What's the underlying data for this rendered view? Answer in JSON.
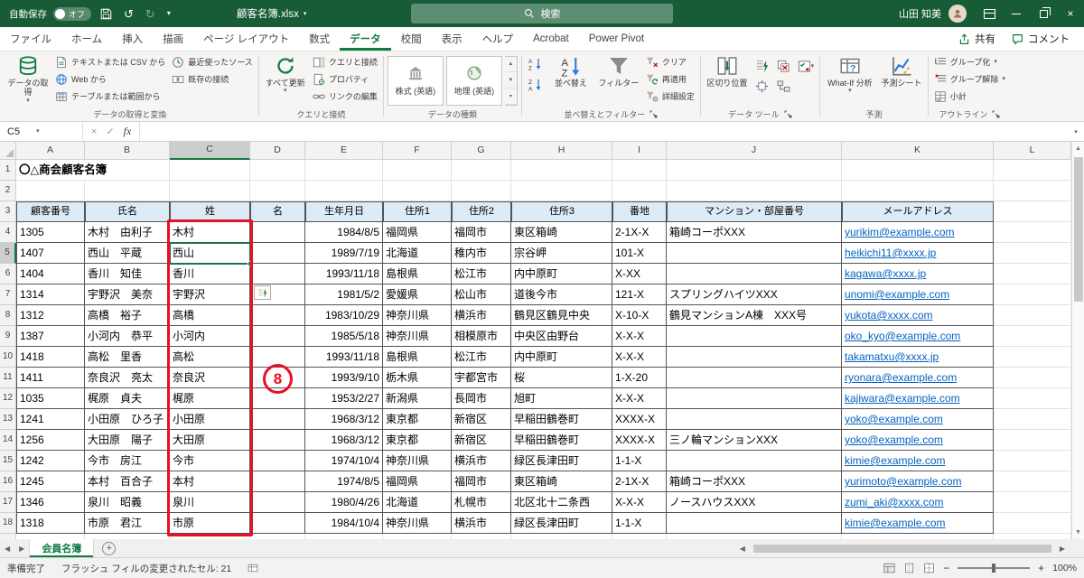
{
  "glyphs": {
    "chevron_down": "▾",
    "undo": "↺",
    "redo": "↻",
    "close": "×",
    "scroll_left": "◀",
    "scroll_right": "▶",
    "up": "▲",
    "down": "▼",
    "add_sheet": "+",
    "zoom_out": "−",
    "zoom_in": "+"
  },
  "titlebar": {
    "autosave_label": "自動保存",
    "autosave_state": "オフ",
    "filename": "顧客名簿.xlsx",
    "search_placeholder": "検索",
    "user_name": "山田 知美"
  },
  "ribbon": {
    "tabs": [
      "ファイル",
      "ホーム",
      "挿入",
      "描画",
      "ページ レイアウト",
      "数式",
      "データ",
      "校閲",
      "表示",
      "ヘルプ",
      "Acrobat",
      "Power Pivot"
    ],
    "active_tab": "データ",
    "share_label": "共有",
    "comments_label": "コメント",
    "get_transform": {
      "title": "データの取得と変換",
      "get_data": "データの取得",
      "from_text": "テキストまたは CSV から",
      "from_web": "Web から",
      "from_table": "テーブルまたは範囲から",
      "recent_sources": "最近使ったソース",
      "existing_connections": "既存の接続"
    },
    "queries": {
      "title": "クエリと接続",
      "refresh_all": "すべて更新",
      "queries_connections": "クエリと接続",
      "properties": "プロパティ",
      "edit_links": "リンクの編集"
    },
    "data_types": {
      "title": "データの種類",
      "stocks": "株式 (英語)",
      "geography": "地理 (英語)"
    },
    "sort_filter": {
      "title": "並べ替えとフィルター",
      "sort": "並べ替え",
      "filter": "フィルター",
      "clear": "クリア",
      "reapply": "再適用",
      "advanced": "詳細設定"
    },
    "data_tools": {
      "title": "データ ツール",
      "text_to_columns": "区切り位置"
    },
    "forecast": {
      "title": "予測",
      "what_if": "What-If 分析",
      "forecast_sheet": "予測シート"
    },
    "outline": {
      "title": "アウトライン",
      "group": "グループ化",
      "ungroup": "グループ解除",
      "subtotal": "小計"
    }
  },
  "formula_bar": {
    "name_box": "C5",
    "fx_label": "fx",
    "formula": ""
  },
  "sheet": {
    "columns": [
      "A",
      "B",
      "C",
      "D",
      "E",
      "F",
      "G",
      "H",
      "I",
      "J",
      "K",
      "L"
    ],
    "selected_cell": "C5",
    "selected_column": "C",
    "selected_row": 5,
    "title_cell": "〇△商会顧客名簿",
    "headers": [
      "顧客番号",
      "氏名",
      "姓",
      "名",
      "生年月日",
      "住所1",
      "住所2",
      "住所3",
      "番地",
      "マンション・部屋番号",
      "メールアドレス"
    ],
    "rows": [
      [
        "1305",
        "木村　由利子",
        "木村",
        "",
        "1984/8/5",
        "福岡県",
        "福岡市",
        "東区箱崎",
        "2-1X-X",
        "箱崎コーポXXX",
        "yurikim@example.com"
      ],
      [
        "1407",
        "西山　平蔵",
        "西山",
        "",
        "1989/7/19",
        "北海道",
        "稚内市",
        "宗谷岬",
        "101-X",
        "",
        "heikichi11@xxxx.jp"
      ],
      [
        "1404",
        "香川　知佳",
        "香川",
        "",
        "1993/11/18",
        "島根県",
        "松江市",
        "内中原町",
        "X-XX",
        "",
        "kagawa@xxxx.jp"
      ],
      [
        "1314",
        "宇野沢　美奈",
        "宇野沢",
        "",
        "1981/5/2",
        "愛媛県",
        "松山市",
        "道後今市",
        "121-X",
        "スプリングハイツXXX",
        "unomi@example.com"
      ],
      [
        "1312",
        "高橋　裕子",
        "高橋",
        "",
        "1983/10/29",
        "神奈川県",
        "横浜市",
        "鶴見区鶴見中央",
        "X-10-X",
        "鶴見マンションA棟　XXX号",
        "yukota@xxxx.com"
      ],
      [
        "1387",
        "小河内　恭平",
        "小河内",
        "",
        "1985/5/18",
        "神奈川県",
        "相模原市",
        "中央区由野台",
        "X-X-X",
        "",
        "oko_kyo@example.com"
      ],
      [
        "1418",
        "高松　里香",
        "高松",
        "",
        "1993/11/18",
        "島根県",
        "松江市",
        "内中原町",
        "X-X-X",
        "",
        "takamatxu@xxxx.jp"
      ],
      [
        "1411",
        "奈良沢　亮太",
        "奈良沢",
        "",
        "1993/9/10",
        "栃木県",
        "宇都宮市",
        "桜",
        "1-X-20",
        "",
        "ryonara@example.com"
      ],
      [
        "1035",
        "梶原　貞夫",
        "梶原",
        "",
        "1953/2/27",
        "新潟県",
        "長岡市",
        "旭町",
        "X-X-X",
        "",
        "kajiwara@example.com"
      ],
      [
        "1241",
        "小田原　ひろ子",
        "小田原",
        "",
        "1968/3/12",
        "東京都",
        "新宿区",
        "早稲田鶴巻町",
        "XXXX-X",
        "",
        "yoko@example.com"
      ],
      [
        "1256",
        "大田原　陽子",
        "大田原",
        "",
        "1968/3/12",
        "東京都",
        "新宿区",
        "早稲田鶴巻町",
        "XXXX-X",
        "三ノ輪マンションXXX",
        "yoko@example.com"
      ],
      [
        "1242",
        "今市　房江",
        "今市",
        "",
        "1974/10/4",
        "神奈川県",
        "横浜市",
        "緑区長津田町",
        "1-1-X",
        "",
        "kimie@example.com"
      ],
      [
        "1245",
        "本村　百合子",
        "本村",
        "",
        "1974/8/5",
        "福岡県",
        "福岡市",
        "東区箱崎",
        "2-1X-X",
        "箱崎コーポXXX",
        "yurimoto@example.com"
      ],
      [
        "1346",
        "泉川　昭義",
        "泉川",
        "",
        "1980/4/26",
        "北海道",
        "札幌市",
        "北区北十二条西",
        "X-X-X",
        "ノースハウスXXX",
        "zumi_aki@xxxx.com"
      ],
      [
        "1318",
        "市原　君江",
        "市原",
        "",
        "1984/10/4",
        "神奈川県",
        "横浜市",
        "緑区長津田町",
        "1-1-X",
        "",
        "kimie@example.com"
      ]
    ]
  },
  "annotation": {
    "circle_number": "8"
  },
  "sheet_tabs": {
    "active_tab": "会員名簿"
  },
  "status_bar": {
    "ready_label": "準備完了",
    "flash_fill_message": "フラッシュ フィルの変更されたセル: 21",
    "zoom_level": "100%"
  },
  "colors": {
    "titlebar_green": "#185C37",
    "accent_green": "#107C41",
    "header_fill": "#DDEBF7",
    "hyperlink_blue": "#0563C1",
    "annotation_red": "#E81123"
  }
}
